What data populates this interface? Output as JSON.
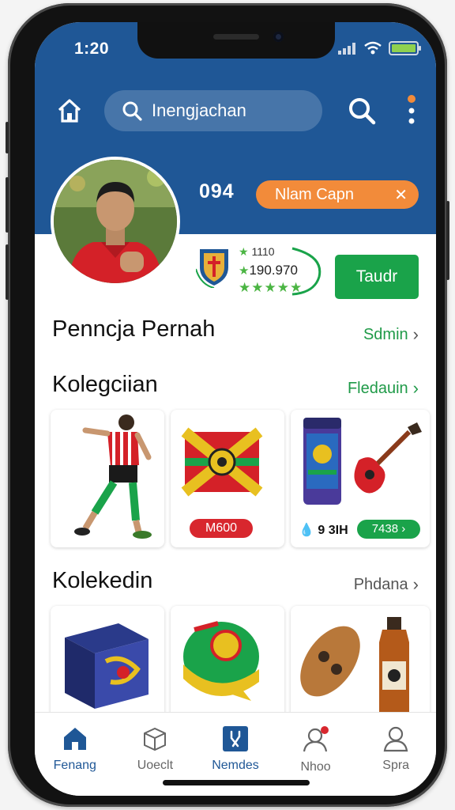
{
  "status": {
    "time": "1:20"
  },
  "search": {
    "placeholder": "Inengjachan"
  },
  "profile": {
    "number": "094",
    "tag_label": "Nlam Capn",
    "rating_line1": "1110",
    "rating_value": "190.970",
    "stars": "★★★★★",
    "action_label": "Taudr"
  },
  "sections": [
    {
      "title": "Penncja Pernah",
      "link": "Sdmin"
    },
    {
      "title": "Kolegciian",
      "link": "Fledauin"
    },
    {
      "title": "Kolekedin",
      "link": "Phdana"
    }
  ],
  "collection_cards": [
    {
      "icon": "player-figure-icon"
    },
    {
      "icon": "card-pack-icon",
      "price": "M600"
    },
    {
      "icon": "drink-can-icon",
      "price": "9 3IH"
    },
    {
      "icon": "guitar-icon",
      "price": "7438"
    }
  ],
  "bottom_nav": [
    {
      "label": "Fenang",
      "icon": "home-icon",
      "active": true
    },
    {
      "label": "Uoeclt",
      "icon": "box-icon"
    },
    {
      "label": "Nemdes",
      "icon": "tools-icon",
      "active": true
    },
    {
      "label": "Nhoo",
      "icon": "user-notification-icon"
    },
    {
      "label": "Spra",
      "icon": "user-icon"
    }
  ],
  "colors": {
    "header": "#1f5796",
    "accent_green": "#1aa34a",
    "tag_orange": "#f28b3a",
    "price_red": "#d8272e"
  }
}
